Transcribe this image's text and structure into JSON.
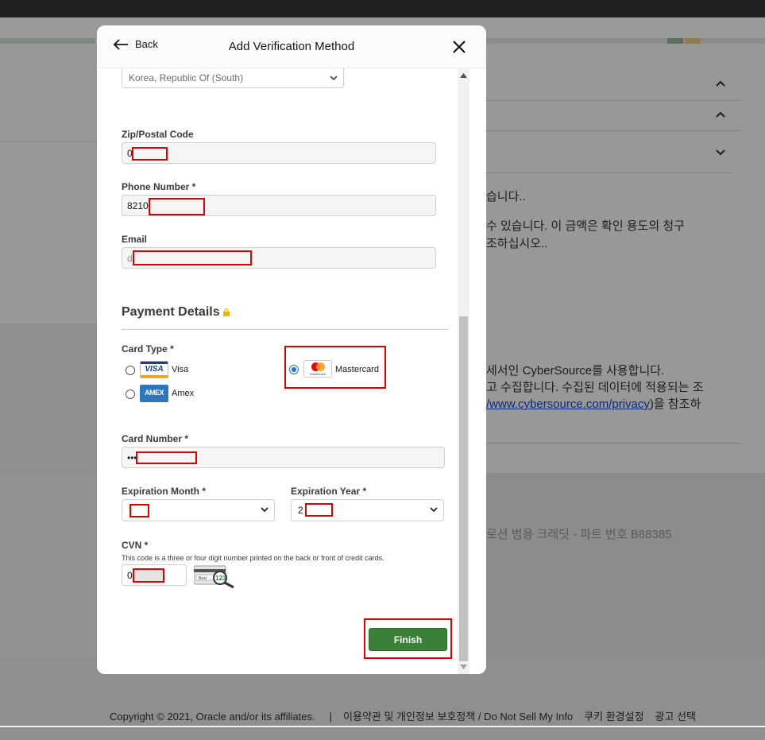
{
  "modal": {
    "back_label": "Back",
    "title": "Add Verification Method",
    "country_value": "Korea, Republic Of (South)",
    "zip": {
      "label": "Zip/Postal Code",
      "value": "0"
    },
    "phone": {
      "label": "Phone Number *",
      "value": "8210"
    },
    "email": {
      "label": "Email",
      "value": "d"
    },
    "payment_title": "Payment Details",
    "card_type": {
      "label": "Card Type *",
      "options": [
        {
          "name": "Visa",
          "logo_text": "VISA",
          "checked": false
        },
        {
          "name": "Amex",
          "logo_text": "AMEX",
          "checked": false
        },
        {
          "name": "Mastercard",
          "logo_text": "mastercard",
          "checked": true
        }
      ]
    },
    "card_number": {
      "label": "Card Number *",
      "value": "•••"
    },
    "exp_month": {
      "label": "Expiration Month *",
      "value": ""
    },
    "exp_year": {
      "label": "Expiration Year *",
      "value": "2"
    },
    "cvn": {
      "label": "CVN *",
      "hint": "This code is a three or four digit number printed on the back or front of credit cards.",
      "value": "0",
      "illustration_text": "123",
      "illustration_small": "Best"
    },
    "finish_label": "Finish"
  },
  "background": {
    "line1": "습니다..",
    "line2": "수 있습니다. 이 금액은 확인 용도의 청구",
    "line3": "조하십시오..",
    "line4": "세서인 CyberSource를 사용합니다.",
    "line5": "고 수집합니다. 수집된 데이터에 적용되는 조",
    "line6_link": "/www.cybersource.com/privacy",
    "line6_rest": ")을 참조하",
    "credit": "로션 범용 크레딧 - 파트 번호 B88385"
  },
  "footer": {
    "copyright": "Copyright © 2021, Oracle and/or its affiliates.",
    "separator": "|",
    "terms": "이용약관 및 개인정보 보호정책 / Do Not Sell My Info",
    "cookies": "쿠키 환경설정",
    "ads": "광고 선택"
  },
  "colors": {
    "finish_button": "#3b7f38",
    "redaction": "#e00000",
    "radio_selected": "#1a6fe6"
  }
}
